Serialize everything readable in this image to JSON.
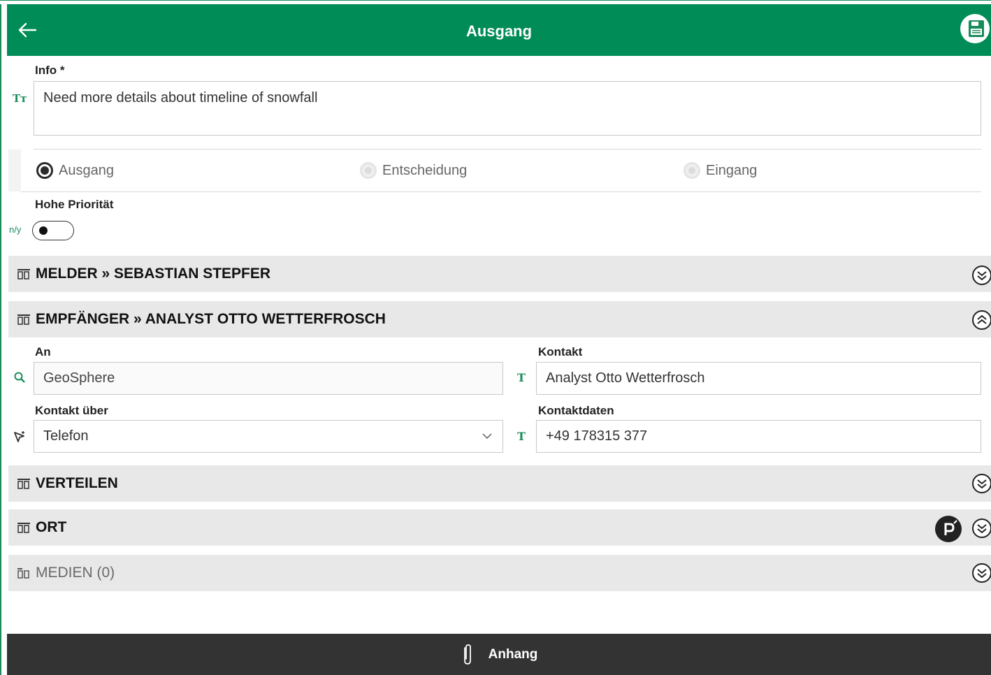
{
  "header": {
    "title": "Ausgang"
  },
  "info": {
    "label": "Info *",
    "icon_text": "Tт",
    "value": "Need more details about timeline of snowfall"
  },
  "direction": {
    "options": [
      {
        "label": "Ausgang",
        "selected": true
      },
      {
        "label": "Entscheidung",
        "selected": false
      },
      {
        "label": "Eingang",
        "selected": false
      }
    ]
  },
  "priority": {
    "label": "Hohe Priorität",
    "prefix": "n/y",
    "value": false
  },
  "sections": {
    "melder": {
      "label": "MELDER » SEBASTIAN STEPFER",
      "expanded": false
    },
    "empfaenger": {
      "label": "EMPFÄNGER » ANALYST OTTO WETTERFROSCH",
      "expanded": true
    },
    "verteilen": {
      "label": "VERTEILEN",
      "expanded": false
    },
    "ort": {
      "label": "ORT",
      "expanded": false
    },
    "medien": {
      "label": "MEDIEN (0)",
      "expanded": false
    }
  },
  "recipient": {
    "an_label": "An",
    "an_value": "GeoSphere",
    "kontakt_label": "Kontakt",
    "kontakt_icon": "T",
    "kontakt_value": "Analyst Otto Wetterfrosch",
    "kontakt_ueber_label": "Kontakt über",
    "kontakt_ueber_value": "Telefon",
    "kontaktdaten_label": "Kontaktdaten",
    "kontaktdaten_icon": "T",
    "kontaktdaten_value": "+49 178315 377"
  },
  "footer": {
    "label": "Anhang"
  },
  "colors": {
    "brand": "#008c56",
    "icon_green": "#1a8c5a",
    "section_bg": "#e8e8e8",
    "footer_bg": "#333333"
  },
  "icons": [
    "back-arrow-icon",
    "save-icon",
    "text-field-icon",
    "search-icon",
    "pointer-select-icon",
    "columns-icon",
    "expand-chevron-icon",
    "collapse-chevron-icon",
    "location-pin-icon",
    "paperclip-icon",
    "dropdown-caret-icon"
  ]
}
